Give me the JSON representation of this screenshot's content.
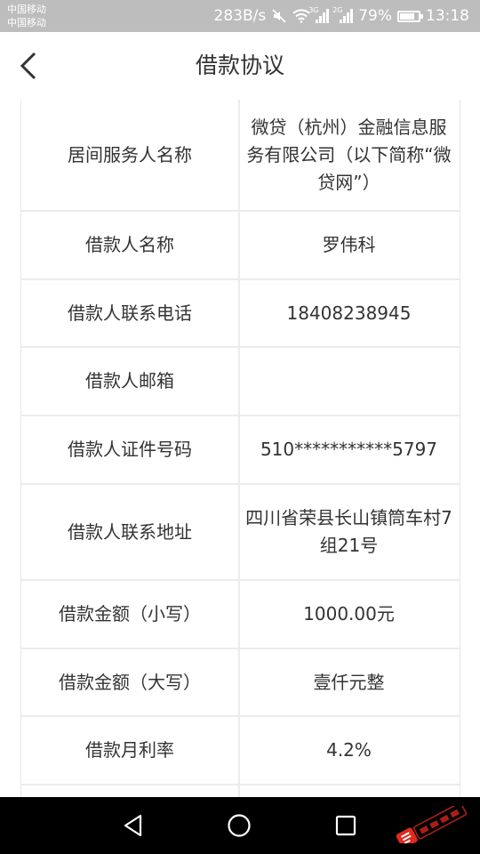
{
  "status_bar": {
    "carrier_1": "中国移动",
    "carrier_2": "中国移动",
    "speed": "283B/s",
    "signal_1_tag": "3G",
    "signal_2_tag": "2G",
    "battery": "79%",
    "battery_level": 0.79,
    "time": "13:18"
  },
  "header": {
    "title": "借款协议"
  },
  "table": {
    "rows": [
      {
        "label": "居间服务人名称",
        "value": "微贷（杭州）金融信息服务有限公司（以下简称“微贷网”）"
      },
      {
        "label": "借款人名称",
        "value": "罗伟科"
      },
      {
        "label": "借款人联系电话",
        "value": "18408238945"
      },
      {
        "label": "借款人邮箱",
        "value": ""
      },
      {
        "label": "借款人证件号码",
        "value": "510***********5797"
      },
      {
        "label": "借款人联系地址",
        "value": "四川省荣县长山镇筒车村7组21号"
      },
      {
        "label": "借款金额（小写）",
        "value": "1000.00元"
      },
      {
        "label": "借款金额（大写）",
        "value": "壹仟元整"
      },
      {
        "label": "借款月利率",
        "value": "4.2%"
      },
      {
        "label": "",
        "value": ""
      }
    ]
  },
  "nav": {
    "back_icon": "triangle-back",
    "home_icon": "circle-home",
    "recents_icon": "square-recents"
  },
  "colors": {
    "status_bar": "#bdbdbd",
    "header_bg": "#ffffff",
    "divider": "#ececec",
    "nav_bar": "#000000",
    "watermark_red": "#e02a1d"
  }
}
